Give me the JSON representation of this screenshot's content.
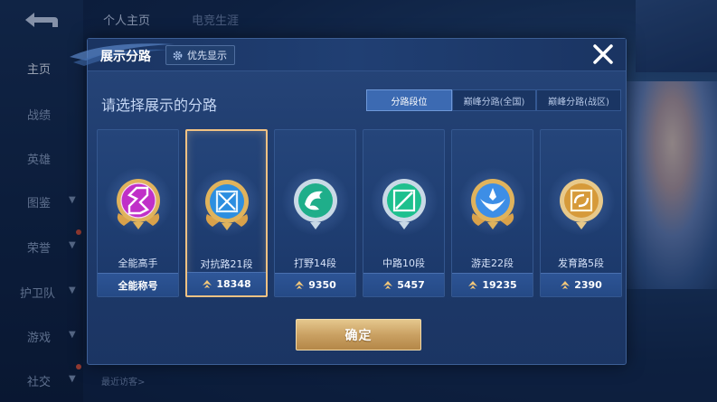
{
  "background": {
    "nav_items": [
      {
        "label": "主页",
        "active": true
      },
      {
        "label": "战绩"
      },
      {
        "label": "英雄"
      },
      {
        "label": "图鉴",
        "chevron": true
      },
      {
        "label": "荣誉",
        "chevron": true
      },
      {
        "label": "护卫队",
        "chevron": true
      },
      {
        "label": "游戏",
        "chevron": true
      },
      {
        "label": "社交",
        "chevron": true
      }
    ],
    "top_tabs": [
      "个人主页",
      "电竞生涯"
    ],
    "recent_visitors": "最近访客>"
  },
  "dialog": {
    "title": "展示分路",
    "priority_label": "优先显示",
    "subtitle": "请选择展示的分路",
    "segments": [
      "分路段位",
      "巅峰分路(全国)",
      "巅峰分路(战区)"
    ],
    "active_segment": 0,
    "cards": [
      {
        "rank": "全能高手",
        "footer": "全能称号",
        "emblem": "all-round-emblem",
        "color": "#c030c8",
        "has_points": false
      },
      {
        "rank": "对抗路21段",
        "footer": "18348",
        "emblem": "clash-lane-emblem",
        "color": "#2d8ee0",
        "has_points": true,
        "selected": true
      },
      {
        "rank": "打野14段",
        "footer": "9350",
        "emblem": "jungle-emblem",
        "color": "#1fae8a",
        "has_points": true
      },
      {
        "rank": "中路10段",
        "footer": "5457",
        "emblem": "mid-lane-emblem",
        "color": "#1ec08e",
        "has_points": true
      },
      {
        "rank": "游走22段",
        "footer": "19235",
        "emblem": "roam-emblem",
        "color": "#3d8ee6",
        "has_points": true
      },
      {
        "rank": "发育路5段",
        "footer": "2390",
        "emblem": "farm-lane-emblem",
        "color": "#d69a3a",
        "has_points": true
      }
    ],
    "confirm_label": "确定"
  }
}
